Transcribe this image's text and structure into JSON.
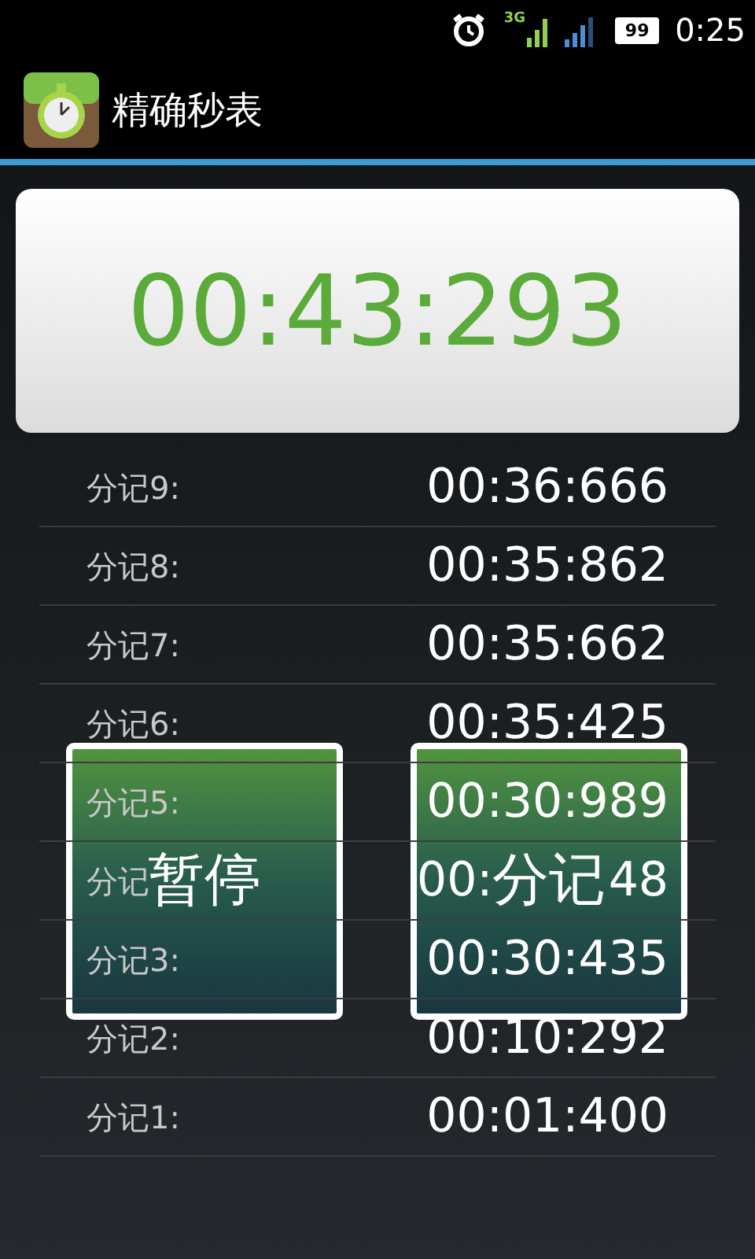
{
  "status_bar": {
    "network": "3G",
    "battery": "99",
    "time": "0:25"
  },
  "app_bar": {
    "title": "精确秒表"
  },
  "display": {
    "time": "00:43:293"
  },
  "laps": [
    {
      "label": "分记9:",
      "time": "00:36:666"
    },
    {
      "label": "分记8:",
      "time": "00:35:862"
    },
    {
      "label": "分记7:",
      "time": "00:35:662"
    },
    {
      "label": "分记6:",
      "time": "00:35:425"
    },
    {
      "label": "分记5:",
      "time": "00:30:989"
    },
    {
      "label": "分记",
      "time_parts": [
        "00:",
        "48"
      ]
    },
    {
      "label": "分记3:",
      "time": "00:30:435"
    },
    {
      "label": "分记2:",
      "time": "00:10:292"
    },
    {
      "label": "分记1:",
      "time": "00:01:400"
    }
  ],
  "buttons": [
    {
      "label": "暂停"
    },
    {
      "label": "分记"
    }
  ]
}
